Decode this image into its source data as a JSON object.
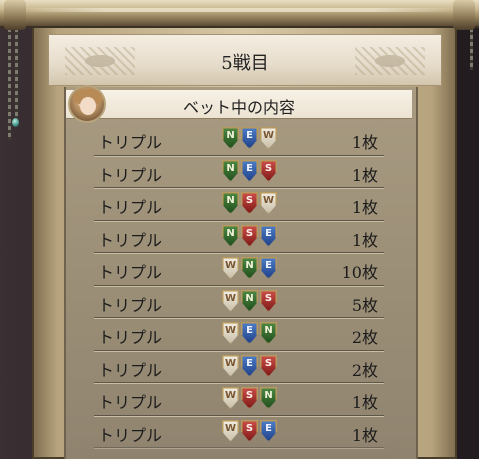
{
  "header": {
    "round_title": "5戦目"
  },
  "panel": {
    "title": "ベット中の内容"
  },
  "bets": [
    {
      "type": "トリプル",
      "combo": [
        "N",
        "E",
        "W"
      ],
      "count": "1枚"
    },
    {
      "type": "トリプル",
      "combo": [
        "N",
        "E",
        "S"
      ],
      "count": "1枚"
    },
    {
      "type": "トリプル",
      "combo": [
        "N",
        "S",
        "W"
      ],
      "count": "1枚"
    },
    {
      "type": "トリプル",
      "combo": [
        "N",
        "S",
        "E"
      ],
      "count": "1枚"
    },
    {
      "type": "トリプル",
      "combo": [
        "W",
        "N",
        "E"
      ],
      "count": "10枚"
    },
    {
      "type": "トリプル",
      "combo": [
        "W",
        "N",
        "S"
      ],
      "count": "5枚"
    },
    {
      "type": "トリプル",
      "combo": [
        "W",
        "E",
        "N"
      ],
      "count": "2枚"
    },
    {
      "type": "トリプル",
      "combo": [
        "W",
        "E",
        "S"
      ],
      "count": "2枚"
    },
    {
      "type": "トリプル",
      "combo": [
        "W",
        "S",
        "N"
      ],
      "count": "1枚"
    },
    {
      "type": "トリプル",
      "combo": [
        "W",
        "S",
        "E"
      ],
      "count": "1枚"
    }
  ],
  "colors": {
    "N": "#2f6b2a",
    "E": "#2d55a8",
    "S": "#a8312c",
    "W": "#e7e1d2",
    "frame": "#c9b88f"
  }
}
